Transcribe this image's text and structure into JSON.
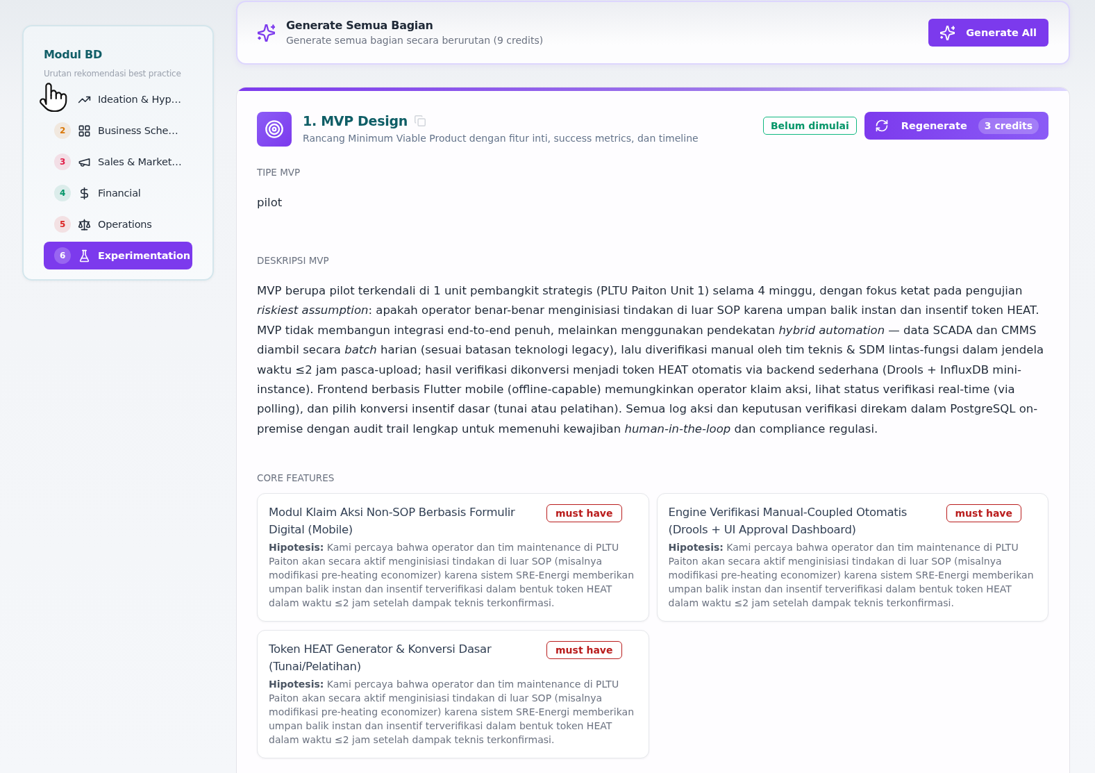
{
  "sidebar": {
    "title": "Modul BD",
    "subtitle": "Urutan rekomendasi best practice",
    "items": [
      {
        "label": "Ideation & Hyp…",
        "selected": false
      },
      {
        "number": "2",
        "label": "Business Sche…",
        "color": "#d97706",
        "selected": false
      },
      {
        "number": "3",
        "label": "Sales & Market…",
        "color": "#e11d48",
        "selected": false
      },
      {
        "number": "4",
        "label": "Financial",
        "color": "#059669",
        "selected": false
      },
      {
        "number": "5",
        "label": "Operations",
        "color": "#dc2626",
        "selected": false
      },
      {
        "number": "6",
        "label": "Experimentation",
        "selected": true
      }
    ]
  },
  "generate_all": {
    "title": "Generate Semua Bagian",
    "subtitle": "Generate semua bagian secara berurutan (9 credits)",
    "button": "Generate All"
  },
  "section": {
    "title": "1. MVP Design",
    "subtitle": "Rancang Minimum Viable Product dengan fitur inti, success metrics, dan timeline",
    "status": "Belum dimulai",
    "regenerate_button": "Regenerate",
    "credits": "3 credits",
    "fields": [
      {
        "label": "TIPE MVP",
        "value": "pilot"
      },
      {
        "label": "DESKRIPSI MVP",
        "value": "MVP berupa pilot terkendali di 1 unit pembangkit strategis (PLTU Paiton Unit 1) selama 4 minggu, dengan fokus ketat pada pengujian *riskiest assumption*: apakah operator benar-benar menginisiasi tindakan di luar SOP karena umpan balik instan dan insentif token HEAT. MVP tidak membangun integrasi end-to-end penuh, melainkan menggunakan pendekatan *hybrid automation* — data SCADA dan CMMS diambil secara *batch* harian (sesuai batasan teknologi legacy), lalu diverifikasi manual oleh tim teknis & SDM lintas-fungsi dalam jendela waktu ≤2 jam pasca-upload; hasil verifikasi dikonversi menjadi token HEAT otomatis via backend sederhana (Drools + InfluxDB mini-instance). Frontend berbasis Flutter mobile (offline-capable) memungkinkan operator klaim aksi, lihat status verifikasi real-time (via polling), dan pilih konversi insentif dasar (tunai atau pelatihan). Semua log aksi dan keputusan verifikasi direkam dalam PostgreSQL on-premise dengan audit trail lengkap untuk memenuhi kewajiban *human-in-the-loop* dan compliance regulasi."
      }
    ],
    "core_features": {
      "label": "CORE FEATURES",
      "items": [
        {
          "title": "Modul Klaim Aksi Non-SOP Berbasis Formulir Digital (Mobile)",
          "priority": "must have",
          "hypothesis": "**Hipotesis:** Kami percaya bahwa operator dan tim maintenance di PLTU Paiton akan secara aktif menginisiasi tindakan di luar SOP (misalnya modifikasi pre-heating economizer) karena sistem SRE-Energi memberikan umpan balik instan dan insentif terverifikasi dalam bentuk token HEAT dalam waktu ≤2 jam setelah dampak teknis terkonfirmasi."
        },
        {
          "title": "Engine Verifikasi Manual-Coupled Otomatis (Drools + UI Approval Dashboard)",
          "priority": "must have",
          "hypothesis": "**Hipotesis:** Kami percaya bahwa operator dan tim maintenance di PLTU Paiton akan secara aktif menginisiasi tindakan di luar SOP (misalnya modifikasi pre-heating economizer) karena sistem SRE-Energi memberikan umpan balik instan dan insentif terverifikasi dalam bentuk token HEAT dalam waktu ≤2 jam setelah dampak teknis terkonfirmasi."
        },
        {
          "title": "Token HEAT Generator & Konversi Dasar (Tunai/Pelatihan)",
          "priority": "must have",
          "hypothesis": "**Hipotesis:** Kami percaya bahwa operator dan tim maintenance di PLTU Paiton akan secara aktif menginisiasi tindakan di luar SOP (misalnya modifikasi pre-heating economizer) karena sistem SRE-Energi memberikan umpan balik instan dan insentif terverifikasi dalam bentuk token HEAT dalam waktu ≤2 jam setelah dampak teknis terkonfirmasi."
        }
      ]
    }
  }
}
